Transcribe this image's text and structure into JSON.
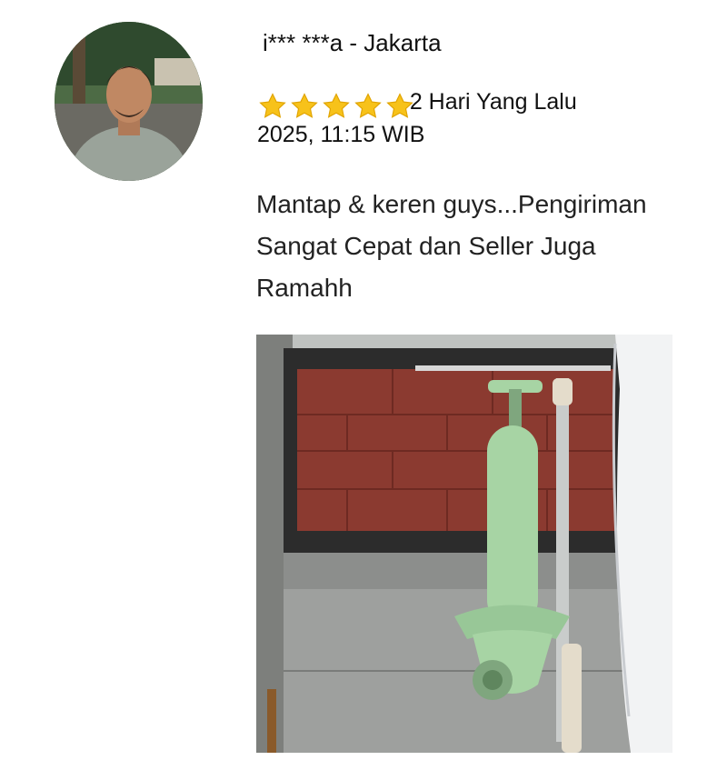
{
  "review": {
    "reviewer": "i*** ***a - Jakarta",
    "rating": 5,
    "rating_max": 5,
    "relative_time": "2 Hari Yang Lalu",
    "datetime": "2025, 11:15 WIB",
    "text": "Mantap & keren guys...Pengiriman Sangat Cepat dan Seller Juga Ramahh"
  },
  "colors": {
    "star": "#f7c21a",
    "tile": "#8b3a30",
    "plunger": "#a7d4a4"
  },
  "icons": {
    "star": "star-icon"
  }
}
